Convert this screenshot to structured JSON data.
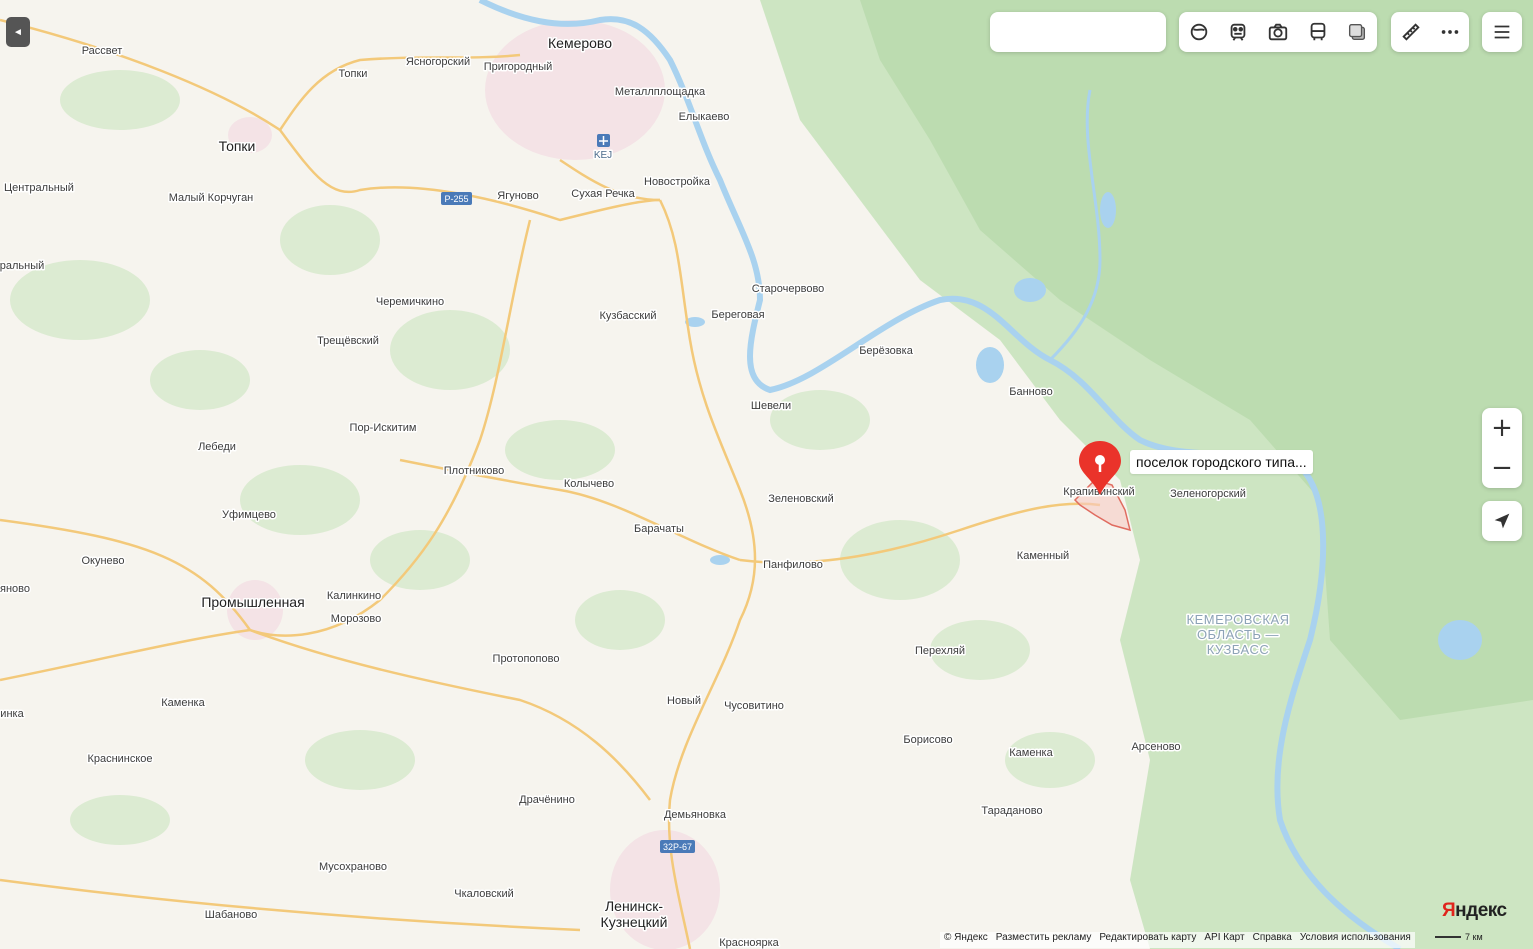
{
  "map": {
    "cities": {
      "kemerovo": "Кемерово",
      "topki": "Топки",
      "promyshlennaya": "Промышленная",
      "leninsk": [
        "Ленинск-",
        "Кузнецкий"
      ]
    },
    "places": {
      "rassvet": "Рассвет",
      "topki_village": "Топки",
      "yasnogorskiy": "Ясногорский",
      "prigorodnyy": "Пригородный",
      "metallploshchadka": "Металлплощадка",
      "elykaevo": "Елыкаево",
      "kej": "KEJ",
      "tsentralnyy": "Центральный",
      "tsentralnyy_cut": "ральный",
      "malyy_korchugan": "Малый Корчуган",
      "yagunovo": "Ягуново",
      "sukhaya_rechka": "Сухая Речка",
      "novostroyka": "Новостройка",
      "staro": "Старочервово",
      "cheremichkino": "Черемичкино",
      "kuzbasskiy": "Кузбасский",
      "beregovaya": "Береговая",
      "berezovka": "Берёзовка",
      "treshchevskiy": "Трещёвский",
      "bannovo": "Банново",
      "shevli": "Шевели",
      "por_iskitim": "Пор-Искитим",
      "lebedi": "Лебеди",
      "plotnikovo": "Плотниково",
      "kolychevo": "Колычево",
      "zelenovskiy": "Зеленовский",
      "kraplivinskiy": "Крапивинский",
      "zelenogorskiy": "Зеленогорский",
      "ufimtsevo": "Уфимцево",
      "barachaty": "Барачаты",
      "kamennyy": "Каменный",
      "okunevo": "Окунево",
      "panfilovo": "Панфилово",
      "yanovo": "яново",
      "kalinkino": "Калинкино",
      "morozovo": "Морозово",
      "perekhlyay": "Перехляй",
      "protopopovo": "Протопопово",
      "kamenka_w": "Каменка",
      "novyy": "Новый",
      "chusovitino": "Чусовитино",
      "inka": "инка",
      "borisovo": "Борисово",
      "kamenka_e": "Каменка",
      "arsenovo": "Арсеново",
      "krasninskoe": "Краснинское",
      "drachenino": "Драчёнино",
      "demyanovka": "Демьяновка",
      "taradanovo": "Тараданово",
      "musokhranovo": "Мусохраново",
      "chkalovskiy": "Чкаловский",
      "shabanovo": "Шабаново",
      "krasnoyarka": "Красноярка"
    },
    "region": [
      "КЕМЕРОВСКАЯ",
      "ОБЛАСТЬ —",
      "КУЗБАСС"
    ],
    "road_shields": {
      "r255": "Р-255",
      "r67": "32Р-67"
    },
    "colors": {
      "land": "#f6f4ee",
      "forest": "#cfe7c5",
      "forest_dense": "#b5d8a8",
      "water": "#aad3f0",
      "road": "#f3c97a",
      "urban": "#f3e3e6",
      "marker": "#e8302a"
    }
  },
  "marker": {
    "label": "поселок городского типа..."
  },
  "controls": {
    "collapse": "◄",
    "zoom_in": "+",
    "zoom_out": "−"
  },
  "brand": {
    "first": "Я",
    "rest": "ндекс"
  },
  "footer": {
    "copyright": "© Яндекс",
    "ads": "Разместить рекламу",
    "edit": "Редактировать карту",
    "api": "API Карт",
    "help": "Справка",
    "terms": "Условия использования"
  },
  "scale": {
    "label": "7 км"
  }
}
